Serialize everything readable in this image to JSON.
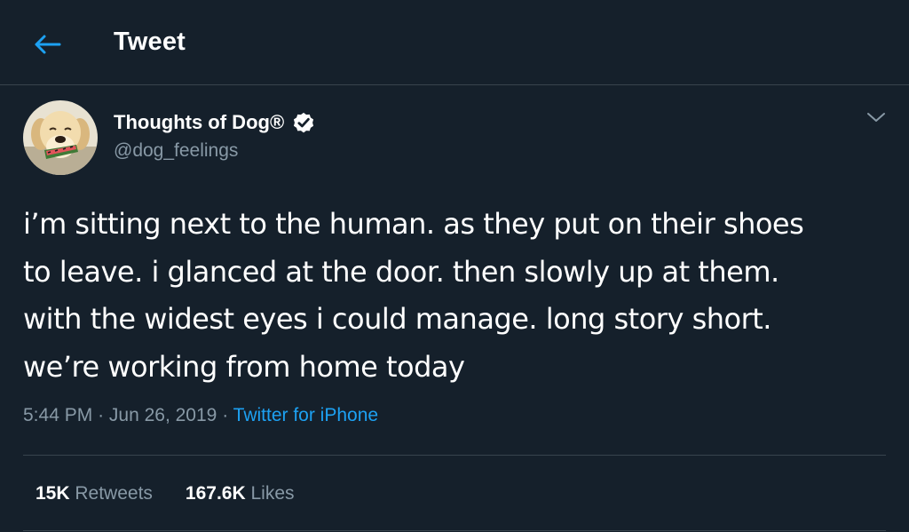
{
  "header": {
    "title": "Tweet",
    "back_icon": "arrow-left-icon"
  },
  "author": {
    "name": "Thoughts of Dog®",
    "handle": "@dog_feelings",
    "verified": true,
    "avatar": "dog-avatar"
  },
  "tweet": {
    "lines": [
      "i’m sitting next to the human. as they put on their shoes",
      "to leave. i glanced at the door. then slowly up at them.",
      "with the widest eyes i could manage. long story short.",
      "we’re working from home today"
    ],
    "time": "5:44 PM",
    "separator": "·",
    "date": "Jun 26, 2019",
    "source": "Twitter for iPhone"
  },
  "stats": {
    "retweets_count": "15K",
    "retweets_label": "Retweets",
    "likes_count": "167.6K",
    "likes_label": "Likes"
  },
  "colors": {
    "background": "#15202b",
    "accent": "#1da1f2",
    "secondary_text": "#8899a6",
    "border": "#38444d"
  }
}
